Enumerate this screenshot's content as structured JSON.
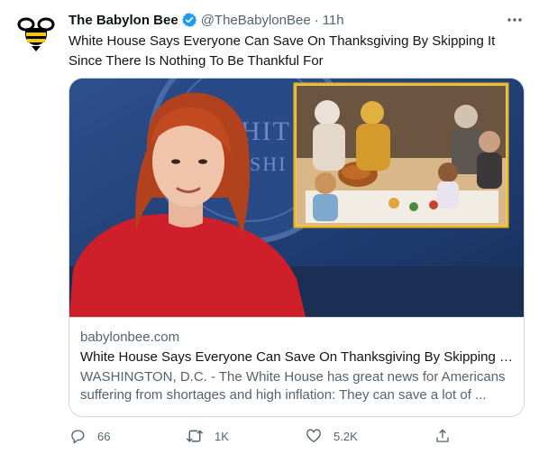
{
  "author": {
    "display_name": "The Babylon Bee",
    "handle": "@TheBabylonBee",
    "separator": "·",
    "time": "11h",
    "verified": true,
    "avatar_icon": "bee-logo-icon"
  },
  "tweet": {
    "text": "White House Says Everyone Can Save On Thanksgiving By Skipping It Since There Is Nothing To Be Thankful For"
  },
  "card": {
    "image_icon": "article-photo",
    "domain": "babylonbee.com",
    "title": "White House Says Everyone Can Save On Thanksgiving By Skipping It Since There Is Nothing To Be Thankful For",
    "description": "WASHINGTON, D.C. - The White House has great news for Americans suffering from shortages and high inflation: They can save a lot of ..."
  },
  "actions": {
    "reply_count": "66",
    "retweet_count": "1K",
    "like_count": "5.2K",
    "share_icon": "share-icon"
  },
  "colors": {
    "text_primary": "#0f1419",
    "text_secondary": "#536471",
    "border": "#cfd9de",
    "verified_blue": "#1d9bf0",
    "card_inset_border": "#e8b81e"
  }
}
